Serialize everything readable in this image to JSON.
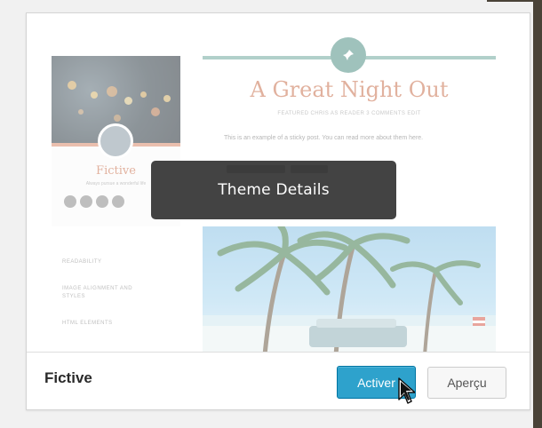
{
  "theme_card": {
    "preview": {
      "site_name": "Fictive",
      "site_tagline": "Always pursue a wonderful life",
      "menu_items": [
        "READABILITY",
        "IMAGE ALIGNMENT AND STYLES",
        "HTML ELEMENTS"
      ],
      "post": {
        "title": "A Great Night Out",
        "meta": "FEATURED      CHRIS AS READER      3 COMMENTS      EDIT",
        "excerpt": "This is an example of a sticky post. You can read more about them here."
      }
    },
    "overlay": {
      "label": "Theme Details"
    },
    "footer": {
      "theme_name": "Fictive",
      "activate_label": "Activer",
      "preview_label": "Aperçu"
    }
  },
  "colors": {
    "accent": "#2ea2cc",
    "title_color": "#c86f4c",
    "teal": "#4e8f83"
  },
  "icons": [
    "pin-icon",
    "avatar",
    "facebook-icon",
    "instagram-icon",
    "pinterest-icon",
    "tumblr-icon",
    "mouse-cursor-icon"
  ]
}
